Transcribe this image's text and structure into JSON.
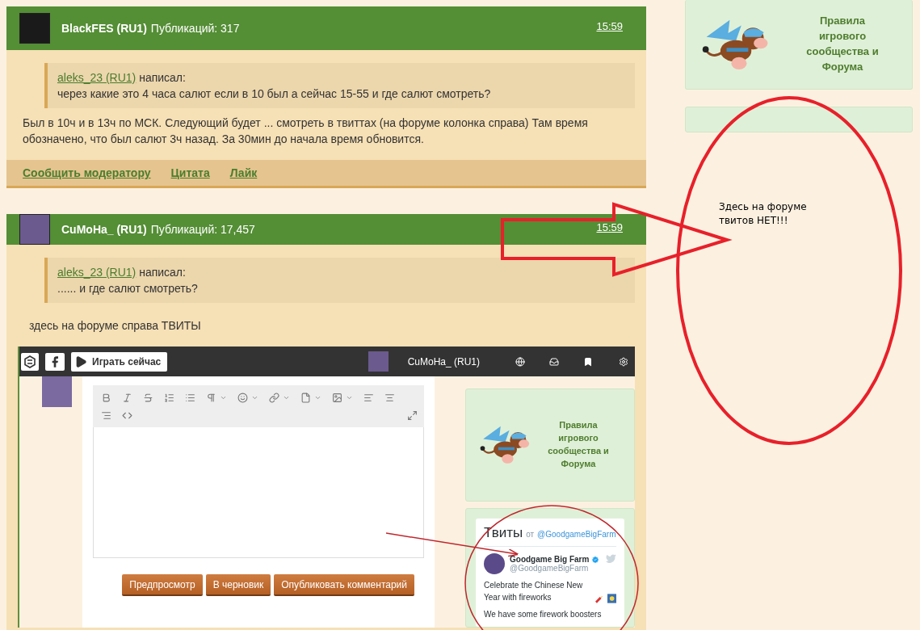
{
  "posts": [
    {
      "author": "BlackFES (RU1)",
      "count_label": "Публикаций:",
      "count": "317",
      "time": "15:59",
      "quote": {
        "author": "aleks_23 (RU1)",
        "verb": "написал:",
        "text": "через какие это 4 часа салют если в 10 был а сейчас 15-55 и где салют смотреть?"
      },
      "text": "Был в 10ч и в 13ч по МСК. Следующий будет ... смотреть в твиттах (на форуме колонка справа) Там время обозначено, что был салют 3ч назад. За 30мин до начала время обновится.",
      "actions": [
        "Сообщить модератору",
        "Цитата",
        "Лайк"
      ]
    },
    {
      "author": "CuMoHa_ (RU1)",
      "count_label": "Публикаций:",
      "count": "17,457",
      "time": "15:59",
      "quote": {
        "author": "aleks_23 (RU1)",
        "verb": "написал:",
        "text": "...... и где салют смотреть?"
      },
      "text": "здесь на форуме справа ТВИТЫ"
    }
  ],
  "embedded_screenshot": {
    "play_button": "Играть сейчас",
    "username": "CuMoHa_ (RU1)",
    "editor_buttons": [
      "Предпросмотр",
      "В черновик",
      "Опубликовать комментарий"
    ],
    "rules_card": "Правила игрового сообщества и Форума",
    "tweets": {
      "title": "Твиты",
      "from": "от",
      "handle": "@GoodgameBigFarm",
      "tweet_name": "Goodgame Big Farm",
      "tweet_handle": "@GoodgameBigFarm",
      "tweet_text": "Celebrate the Chinese New Year with fireworks",
      "tweet_more": "We have some firework boosters"
    }
  },
  "sidebar": {
    "rules_card": "Правила игрового сообщества и Форума"
  },
  "annotation": {
    "note": "Здесь на форуме твитов НЕТ!!!"
  }
}
